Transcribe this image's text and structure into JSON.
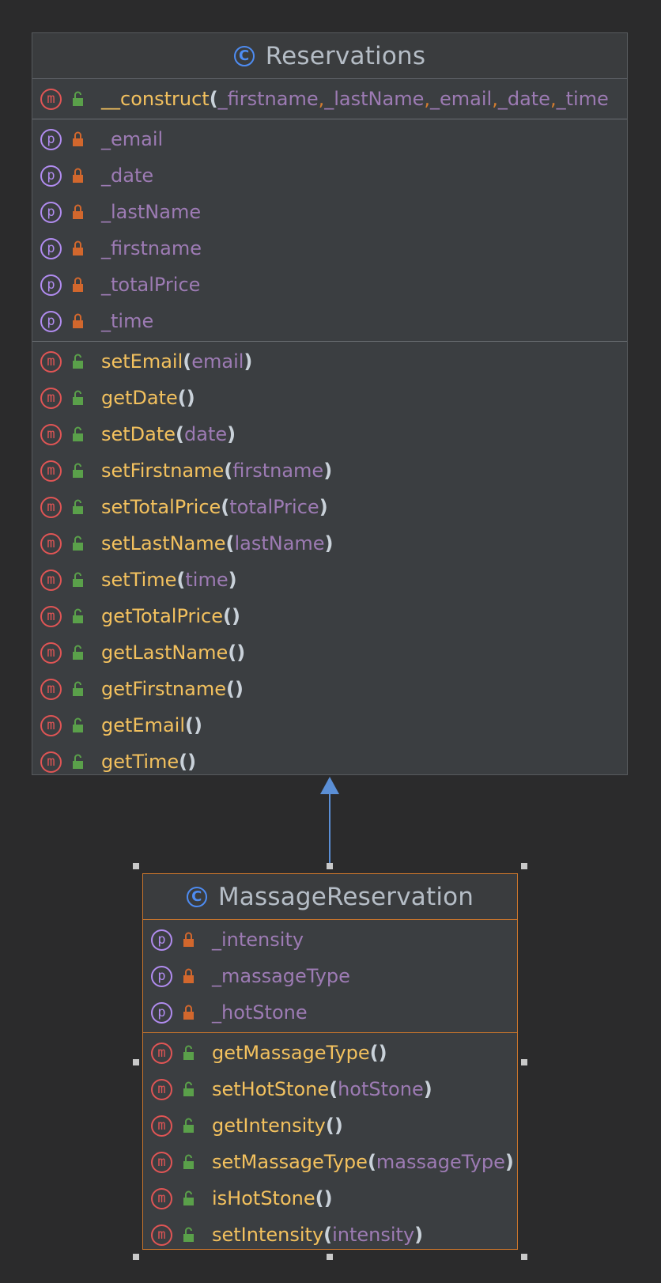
{
  "classes": {
    "reservations": {
      "name": "Reservations",
      "constructor": {
        "name": "__construct",
        "params": [
          "_firstname",
          "_lastName",
          "_email",
          "_date",
          "_time"
        ]
      },
      "fields": [
        "_email",
        "_date",
        "_lastName",
        "_firstname",
        "_totalPrice",
        "_time"
      ],
      "methods": [
        {
          "name": "setEmail",
          "params": "email"
        },
        {
          "name": "getDate",
          "params": ""
        },
        {
          "name": "setDate",
          "params": "date"
        },
        {
          "name": "setFirstname",
          "params": "firstname"
        },
        {
          "name": "setTotalPrice",
          "params": "totalPrice"
        },
        {
          "name": "setLastName",
          "params": "lastName"
        },
        {
          "name": "setTime",
          "params": "time"
        },
        {
          "name": "getTotalPrice",
          "params": ""
        },
        {
          "name": "getLastName",
          "params": ""
        },
        {
          "name": "getFirstname",
          "params": ""
        },
        {
          "name": "getEmail",
          "params": ""
        },
        {
          "name": "getTime",
          "params": ""
        }
      ]
    },
    "massage_reservation": {
      "name": "MassageReservation",
      "fields": [
        "_intensity",
        "_massageType",
        "_hotStone"
      ],
      "methods": [
        {
          "name": "getMassageType",
          "params": ""
        },
        {
          "name": "setHotStone",
          "params": "hotStone"
        },
        {
          "name": "getIntensity",
          "params": ""
        },
        {
          "name": "setMassageType",
          "params": "massageType"
        },
        {
          "name": "isHotStone",
          "params": ""
        },
        {
          "name": "setIntensity",
          "params": "intensity"
        }
      ]
    }
  },
  "icons": {
    "class": "C",
    "method": "m",
    "field": "p"
  },
  "colors": {
    "class_icon": "#4e8cf2",
    "method_badge": "#e05555",
    "field_badge": "#b18cf0",
    "public_lock": "#5aa04a",
    "private_lock": "#d2672d",
    "selection_border": "#c9752c",
    "arrow": "#4e8cf2"
  }
}
